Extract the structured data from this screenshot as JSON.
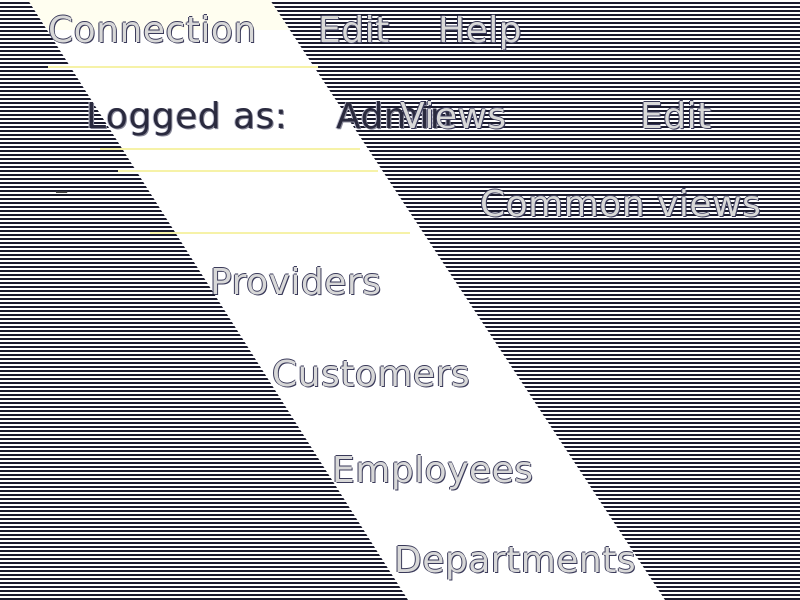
{
  "menubar": {
    "connection": "Connection",
    "edit": "Edit",
    "help": "Help"
  },
  "toolbar": {
    "logged_label": "Logged as:",
    "logged_user": "Admin",
    "views": "Views",
    "edit": "Edit"
  },
  "tree": {
    "toggle": "−",
    "group": "Common views",
    "items": [
      "Providers",
      "Customers",
      "Employees",
      "Departments"
    ]
  }
}
